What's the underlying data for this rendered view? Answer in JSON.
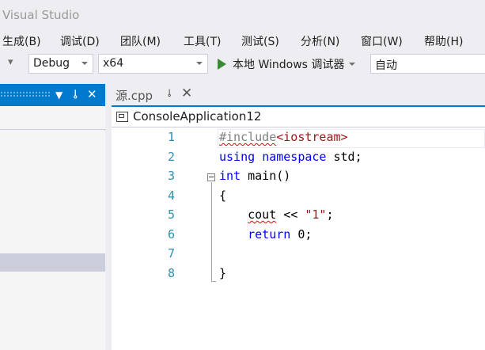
{
  "window": {
    "title": "Visual Studio"
  },
  "menu": [
    {
      "label": "生成(B)"
    },
    {
      "label": "调试(D)"
    },
    {
      "label": "团队(M)"
    },
    {
      "label": "工具(T)"
    },
    {
      "label": "测试(S)"
    },
    {
      "label": "分析(N)"
    },
    {
      "label": "窗口(W)"
    },
    {
      "label": "帮助(H)"
    }
  ],
  "toolbar": {
    "config": "Debug",
    "platform": "x64",
    "run_label": "本地 Windows 调试器",
    "run_mode": "自动"
  },
  "left_panel": {
    "pin_glyph": "⊸",
    "close_glyph": "✕"
  },
  "tab": {
    "filename": "源.cpp",
    "pin_glyph": "⊸",
    "close_glyph": "✕"
  },
  "editor": {
    "project": "ConsoleApplication12",
    "line_numbers": [
      "1",
      "2",
      "3",
      "4",
      "5",
      "6",
      "7",
      "8"
    ],
    "code": {
      "l1_directive": "#include",
      "l1_header": "<iostream>",
      "l2_using": "using",
      "l2_namespace": "namespace",
      "l2_rest": " std;",
      "l3_int": "int",
      "l3_rest": " main()",
      "l4": "{",
      "l5_indent": "    ",
      "l5_cout": "cout",
      "l5_op": " << ",
      "l5_str": "\"1\"",
      "l5_end": ";",
      "l6_indent": "    ",
      "l6_return": "return",
      "l6_rest": " 0;",
      "l8": "}"
    }
  },
  "colors": {
    "accent": "#007acc",
    "keyword": "#0000ff",
    "line_number": "#2b91af",
    "string": "#a31515",
    "run": "#388a34"
  }
}
